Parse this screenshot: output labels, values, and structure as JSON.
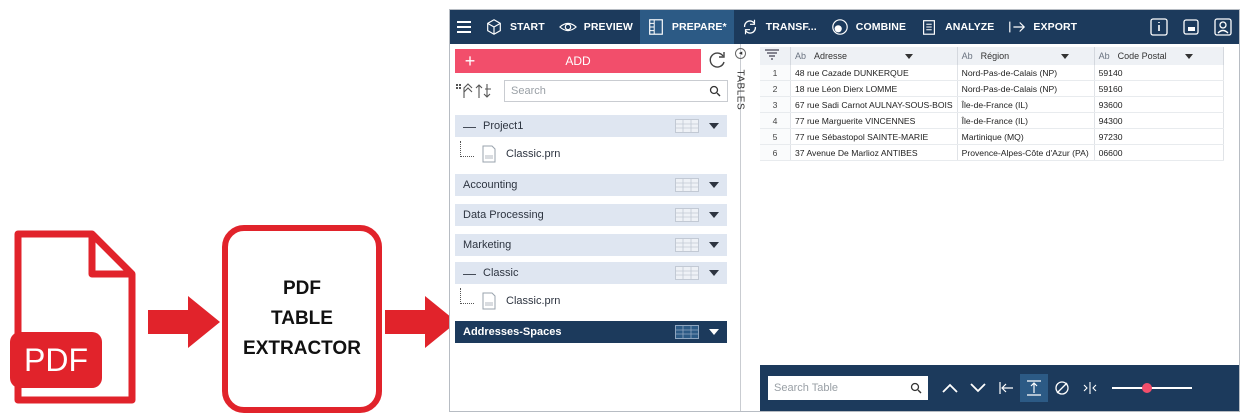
{
  "illustration": {
    "pdf_label": "PDF",
    "extractor_lines": [
      "PDF",
      "TABLE",
      "EXTRACTOR"
    ]
  },
  "toolbar": {
    "items": [
      {
        "label": "START",
        "icon": "cube-icon"
      },
      {
        "label": "PREVIEW",
        "icon": "eye-icon"
      },
      {
        "label": "PREPARE*",
        "icon": "columns-icon",
        "active": true
      },
      {
        "label": "TRANSF...",
        "icon": "transform-icon"
      },
      {
        "label": "COMBINE",
        "icon": "combine-icon"
      },
      {
        "label": "ANALYZE",
        "icon": "clipboard-icon"
      },
      {
        "label": "EXPORT",
        "icon": "export-arrow-icon"
      }
    ]
  },
  "left_panel": {
    "add_label": "ADD",
    "search_placeholder": "Search",
    "tables_tab_label": "TABLES",
    "groups": [
      {
        "name": "Project1",
        "expanded": true,
        "files": [
          "Classic.prn"
        ]
      },
      {
        "name": "Accounting",
        "expanded": false
      },
      {
        "name": "Data Processing",
        "expanded": false
      },
      {
        "name": "Marketing",
        "expanded": false
      },
      {
        "name": "Classic",
        "expanded": true,
        "files": [
          "Classic.prn"
        ]
      },
      {
        "name": "Addresses-Spaces",
        "expanded": false,
        "selected": true
      }
    ]
  },
  "table": {
    "type_prefix": "Ab",
    "columns": [
      "Adresse",
      "Région",
      "Code Postal"
    ],
    "rows": [
      [
        "1",
        "48 rue Cazade DUNKERQUE",
        "Nord-Pas-de-Calais (NP)",
        "59140"
      ],
      [
        "2",
        "18 rue Léon Dierx LOMME",
        "Nord-Pas-de-Calais (NP)",
        "59160"
      ],
      [
        "3",
        "67 rue Sadi Carnot AULNAY-SOUS-BOIS",
        "Île-de-France (IL)",
        "93600"
      ],
      [
        "4",
        "77 rue Marguerite VINCENNES",
        "Île-de-France (IL)",
        "94300"
      ],
      [
        "5",
        "77 rue Sébastopol SAINTE-MARIE",
        "Martinique (MQ)",
        "97230"
      ],
      [
        "6",
        "37 Avenue De Marlioz ANTIBES",
        "Provence-Alpes-Côte d'Azur (PA)",
        "06600"
      ]
    ]
  },
  "bottom_bar": {
    "search_placeholder": "Search Table"
  },
  "colors": {
    "navy": "#1c3a5c",
    "accent_pink": "#f24e6b",
    "brand_red": "#e1232b",
    "group_bg": "#dfe6f1"
  }
}
